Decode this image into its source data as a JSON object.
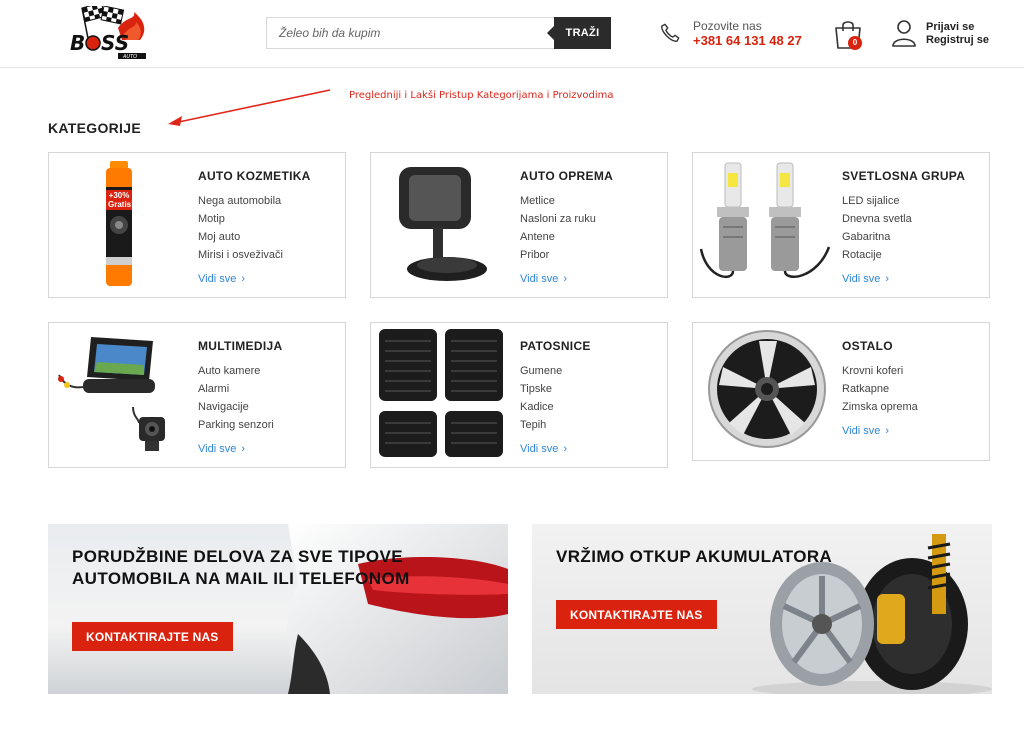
{
  "header": {
    "search_placeholder": "Želeo bih da kupim",
    "search_button": "TRAŽI",
    "phone_label": "Pozovite nas",
    "phone_number": "+381 64 131 48 27",
    "cart_count": "0",
    "login": "Prijavi se",
    "register": "Registruj se"
  },
  "annotation": "Pregledniji i Lakši Pristup Kategorijama i Proizvodima",
  "section_title": "KATEGORIJE",
  "categories": [
    {
      "title": "AUTO KOZMETIKA",
      "items": [
        "Nega automobila",
        "Motip",
        "Moj auto",
        "Mirisi i osveživači"
      ],
      "link": "Vidi sve",
      "image_badge": "+30% Gratis!"
    },
    {
      "title": "AUTO OPREMA",
      "items": [
        "Metlice",
        "Nasloni za ruku",
        "Antene",
        "Pribor"
      ],
      "link": "Vidi sve"
    },
    {
      "title": "SVETLOSNA GRUPA",
      "items": [
        "LED sijalice",
        "Dnevna svetla",
        "Gabaritna",
        "Rotacije"
      ],
      "link": "Vidi sve"
    },
    {
      "title": "MULTIMEDIJA",
      "items": [
        "Auto kamere",
        "Alarmi",
        "Navigacije",
        "Parking senzori"
      ],
      "link": "Vidi sve"
    },
    {
      "title": "PATOSNICE",
      "items": [
        "Gumene",
        "Tipske",
        "Kadice",
        "Tepih"
      ],
      "link": "Vidi sve"
    },
    {
      "title": "OSTALO",
      "items": [
        "Krovni koferi",
        "Ratkapne",
        "Zimska oprema"
      ],
      "link": "Vidi sve"
    }
  ],
  "banners": [
    {
      "line1": "PORUDŽBINE DELOVA ZA SVE TIPOVE",
      "line2": "AUTOMOBILA NA MAIL ILI TELEFONOM",
      "button": "KONTAKTIRAJTE NAS"
    },
    {
      "line1": "VRŽIMO OTKUP AKUMULATORA",
      "button": "KONTAKTIRAJTE NAS"
    }
  ],
  "colors": {
    "accent": "#d9230f",
    "link": "#2f86d8",
    "dark": "#2b2b2b"
  }
}
